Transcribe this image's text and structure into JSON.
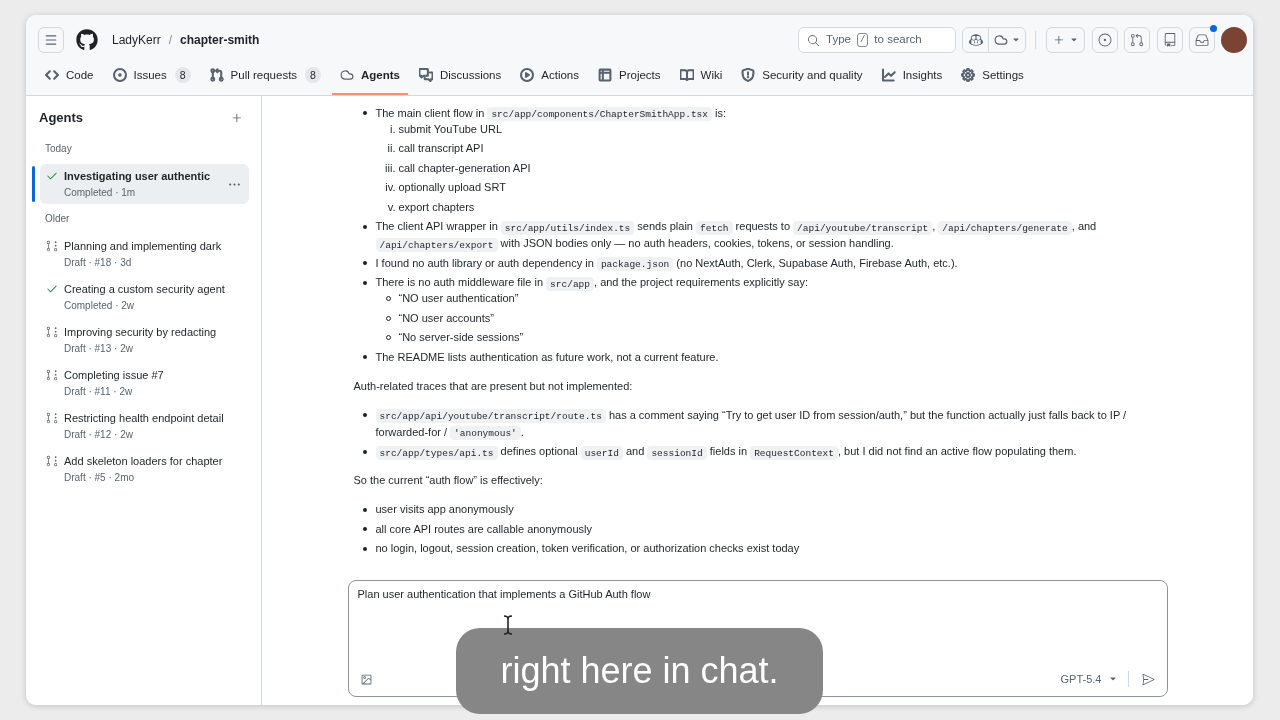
{
  "repo": {
    "owner": "LadyKerr",
    "separator": "/",
    "name": "chapter-smith"
  },
  "search": {
    "placeholder": "Type",
    "key": "/",
    "placeholder_end": "to search"
  },
  "inbox": {
    "unread": true
  },
  "tabs": [
    {
      "kind": "code",
      "label": "Code",
      "selected": false
    },
    {
      "kind": "issues",
      "label": "Issues",
      "count": "8",
      "selected": false
    },
    {
      "kind": "pulls",
      "label": "Pull requests",
      "count": "8",
      "selected": false
    },
    {
      "kind": "agents",
      "label": "Agents",
      "selected": true
    },
    {
      "kind": "discussions",
      "label": "Discussions",
      "selected": false
    },
    {
      "kind": "actions",
      "label": "Actions",
      "selected": false
    },
    {
      "kind": "projects",
      "label": "Projects",
      "selected": false
    },
    {
      "kind": "wiki",
      "label": "Wiki",
      "selected": false
    },
    {
      "kind": "security",
      "label": "Security and quality",
      "selected": false
    },
    {
      "kind": "insights",
      "label": "Insights",
      "selected": false
    },
    {
      "kind": "settings",
      "label": "Settings",
      "selected": false
    }
  ],
  "sidebar": {
    "title": "Agents",
    "groups": [
      {
        "label": "Today",
        "items": [
          {
            "kind": "completed",
            "title": "Investigating user authentic",
            "meta": "Completed · 1m",
            "selected": true
          }
        ]
      },
      {
        "label": "Older",
        "items": [
          {
            "kind": "draft",
            "title": "Planning and implementing dark",
            "meta": "Draft · #18 · 3d",
            "selected": false
          },
          {
            "kind": "completed",
            "title": "Creating a custom security agent",
            "meta": "Completed · 2w",
            "selected": false
          },
          {
            "kind": "draft",
            "title": "Improving security by redacting",
            "meta": "Draft · #13 · 2w",
            "selected": false
          },
          {
            "kind": "draft",
            "title": "Completing issue #7",
            "meta": "Draft · #11 · 2w",
            "selected": false
          },
          {
            "kind": "draft",
            "title": "Restricting health endpoint detail",
            "meta": "Draft · #12 · 2w",
            "selected": false
          },
          {
            "kind": "draft",
            "title": "Add skeleton loaders for chapter",
            "meta": "Draft · #5 · 2mo",
            "selected": false
          }
        ]
      }
    ]
  },
  "conversation": {
    "blocks": [
      {
        "kind": "list",
        "items": [
          {
            "parts": [
              {
                "kind": "text",
                "text": "The main client flow in "
              },
              {
                "kind": "code",
                "text": "src/app/components/ChapterSmithApp.tsx"
              },
              {
                "kind": "text",
                "text": " is:"
              }
            ],
            "sublist": {
              "kind": "ordered",
              "items": [
                {
                  "marker": "i.",
                  "text": "submit YouTube URL"
                },
                {
                  "marker": "ii.",
                  "text": "call transcript API"
                },
                {
                  "marker": "iii.",
                  "text": "call chapter-generation API"
                },
                {
                  "marker": "iv.",
                  "text": "optionally upload SRT"
                },
                {
                  "marker": "v.",
                  "text": "export chapters"
                }
              ]
            }
          },
          {
            "parts": [
              {
                "kind": "text",
                "text": "The client API wrapper in "
              },
              {
                "kind": "code",
                "text": "src/app/utils/index.ts"
              },
              {
                "kind": "text",
                "text": " sends plain "
              },
              {
                "kind": "code",
                "text": "fetch"
              },
              {
                "kind": "text",
                "text": " requests to "
              },
              {
                "kind": "code",
                "text": "/api/youtube/transcript"
              },
              {
                "kind": "text",
                "text": ", "
              },
              {
                "kind": "code",
                "text": "/api/chapters/generate"
              },
              {
                "kind": "text",
                "text": ", and "
              },
              {
                "kind": "code",
                "text": "/api/chapters/export"
              },
              {
                "kind": "text",
                "text": " with JSON bodies only — no auth headers, cookies, tokens, or session handling."
              }
            ]
          },
          {
            "parts": [
              {
                "kind": "text",
                "text": "I found no auth library or auth dependency in "
              },
              {
                "kind": "code",
                "text": "package.json"
              },
              {
                "kind": "text",
                "text": " (no NextAuth, Clerk, Supabase Auth, Firebase Auth, etc.)."
              }
            ]
          },
          {
            "parts": [
              {
                "kind": "text",
                "text": "There is no auth middleware file in "
              },
              {
                "kind": "code",
                "text": "src/app"
              },
              {
                "kind": "text",
                "text": ", and the project requirements explicitly say:"
              }
            ],
            "sublist": {
              "kind": "bullet",
              "items": [
                {
                  "text": "“NO user authentication”"
                },
                {
                  "text": "“NO user accounts”"
                },
                {
                  "text": "“No server-side sessions”"
                }
              ]
            }
          },
          {
            "parts": [
              {
                "kind": "text",
                "text": "The README lists authentication as future work, not a current feature."
              }
            ]
          }
        ]
      },
      {
        "kind": "paragraph",
        "parts": [
          {
            "kind": "text",
            "text": "Auth-related traces that are present but not implemented:"
          }
        ]
      },
      {
        "kind": "list",
        "items": [
          {
            "parts": [
              {
                "kind": "code",
                "text": "src/app/api/youtube/transcript/route.ts"
              },
              {
                "kind": "text",
                "text": " has a comment saying “Try to get user ID from session/auth,” but the function actually just falls back to IP / forwarded-for / "
              },
              {
                "kind": "code",
                "text": "'anonymous'"
              },
              {
                "kind": "text",
                "text": "."
              }
            ]
          },
          {
            "parts": [
              {
                "kind": "code",
                "text": "src/app/types/api.ts"
              },
              {
                "kind": "text",
                "text": " defines optional "
              },
              {
                "kind": "code",
                "text": "userId"
              },
              {
                "kind": "text",
                "text": " and "
              },
              {
                "kind": "code",
                "text": "sessionId"
              },
              {
                "kind": "text",
                "text": " fields in "
              },
              {
                "kind": "code",
                "text": "RequestContext"
              },
              {
                "kind": "text",
                "text": ", but I did not find an active flow populating them."
              }
            ]
          }
        ]
      },
      {
        "kind": "paragraph",
        "parts": [
          {
            "kind": "text",
            "text": "So the current “auth flow” is effectively:"
          }
        ]
      },
      {
        "kind": "list",
        "items": [
          {
            "parts": [
              {
                "kind": "text",
                "text": "user visits app anonymously"
              }
            ]
          },
          {
            "parts": [
              {
                "kind": "text",
                "text": "all core API routes are callable anonymously"
              }
            ]
          },
          {
            "parts": [
              {
                "kind": "text",
                "text": "no login, logout, session creation, token verification, or authorization checks exist today"
              }
            ]
          }
        ]
      }
    ]
  },
  "composer": {
    "value": "Plan user authentication that implements a GitHub Auth flow",
    "model": "GPT-5.4"
  },
  "caption": {
    "text": "right here in chat."
  }
}
